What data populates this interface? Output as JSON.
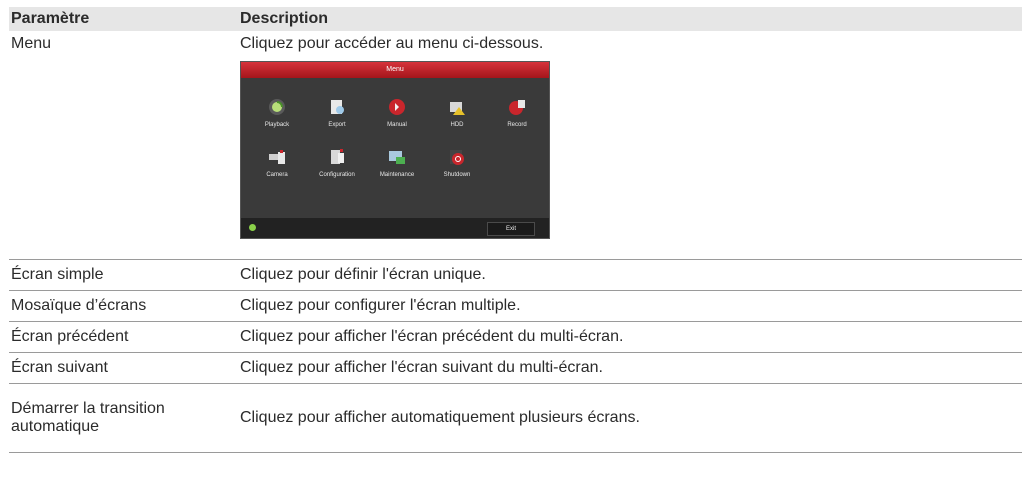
{
  "table": {
    "headers": [
      "Paramètre",
      "Description"
    ],
    "rows": [
      {
        "param": "Menu",
        "desc": "Cliquez pour accéder au menu ci-dessous."
      },
      {
        "param": "Écran simple",
        "desc": "Cliquez pour définir l'écran unique."
      },
      {
        "param": "Mosaïque d’écrans",
        "desc": "Cliquez pour configurer l'écran multiple."
      },
      {
        "param": "Écran précédent",
        "desc": "Cliquez pour afficher l'écran précédent du multi-écran."
      },
      {
        "param": "Écran suivant",
        "desc": "Cliquez pour afficher l'écran suivant du multi-écran."
      },
      {
        "param": "Démarrer la transition automatique",
        "desc": "Cliquez pour afficher automatiquement plusieurs écrans."
      }
    ]
  },
  "menu_screenshot": {
    "title": "Menu",
    "items": [
      {
        "label": "Playback",
        "icon": "playback-icon"
      },
      {
        "label": "Export",
        "icon": "export-icon"
      },
      {
        "label": "Manual",
        "icon": "manual-icon"
      },
      {
        "label": "HDD",
        "icon": "hdd-icon"
      },
      {
        "label": "Record",
        "icon": "record-icon"
      },
      {
        "label": "Camera",
        "icon": "camera-icon"
      },
      {
        "label": "Configuration",
        "icon": "configuration-icon"
      },
      {
        "label": "Maintenance",
        "icon": "maintenance-icon"
      },
      {
        "label": "Shutdown",
        "icon": "shutdown-icon"
      }
    ],
    "exit_label": "Exit"
  }
}
